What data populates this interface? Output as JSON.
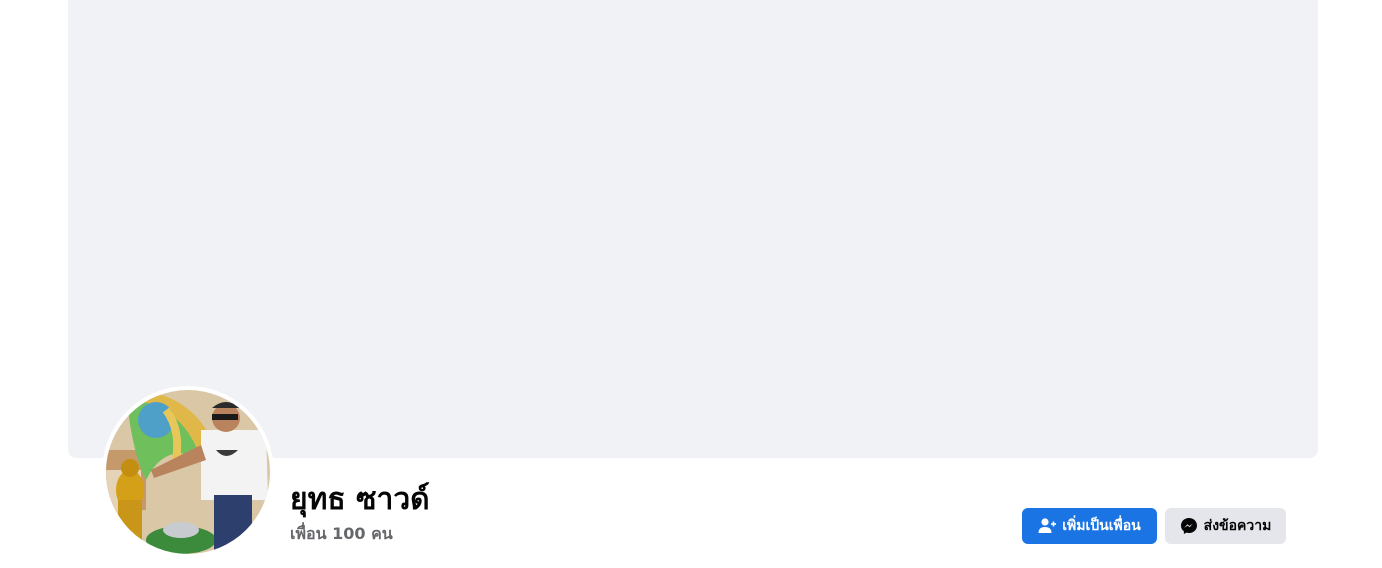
{
  "profile": {
    "name": "ยุทธ ซาวด์",
    "friends_text": "เพื่อน 100 คน"
  },
  "actions": {
    "add_friend_label": "เพิ่มเป็นเพื่อน",
    "add_friend_icon": "add-friend-icon",
    "message_label": "ส่งข้อความ",
    "message_icon": "messenger-icon"
  },
  "colors": {
    "primary": "#1b74e4",
    "secondary_button": "#e4e6eb",
    "cover_background": "#f0f2f5",
    "muted_text": "#65676b"
  }
}
